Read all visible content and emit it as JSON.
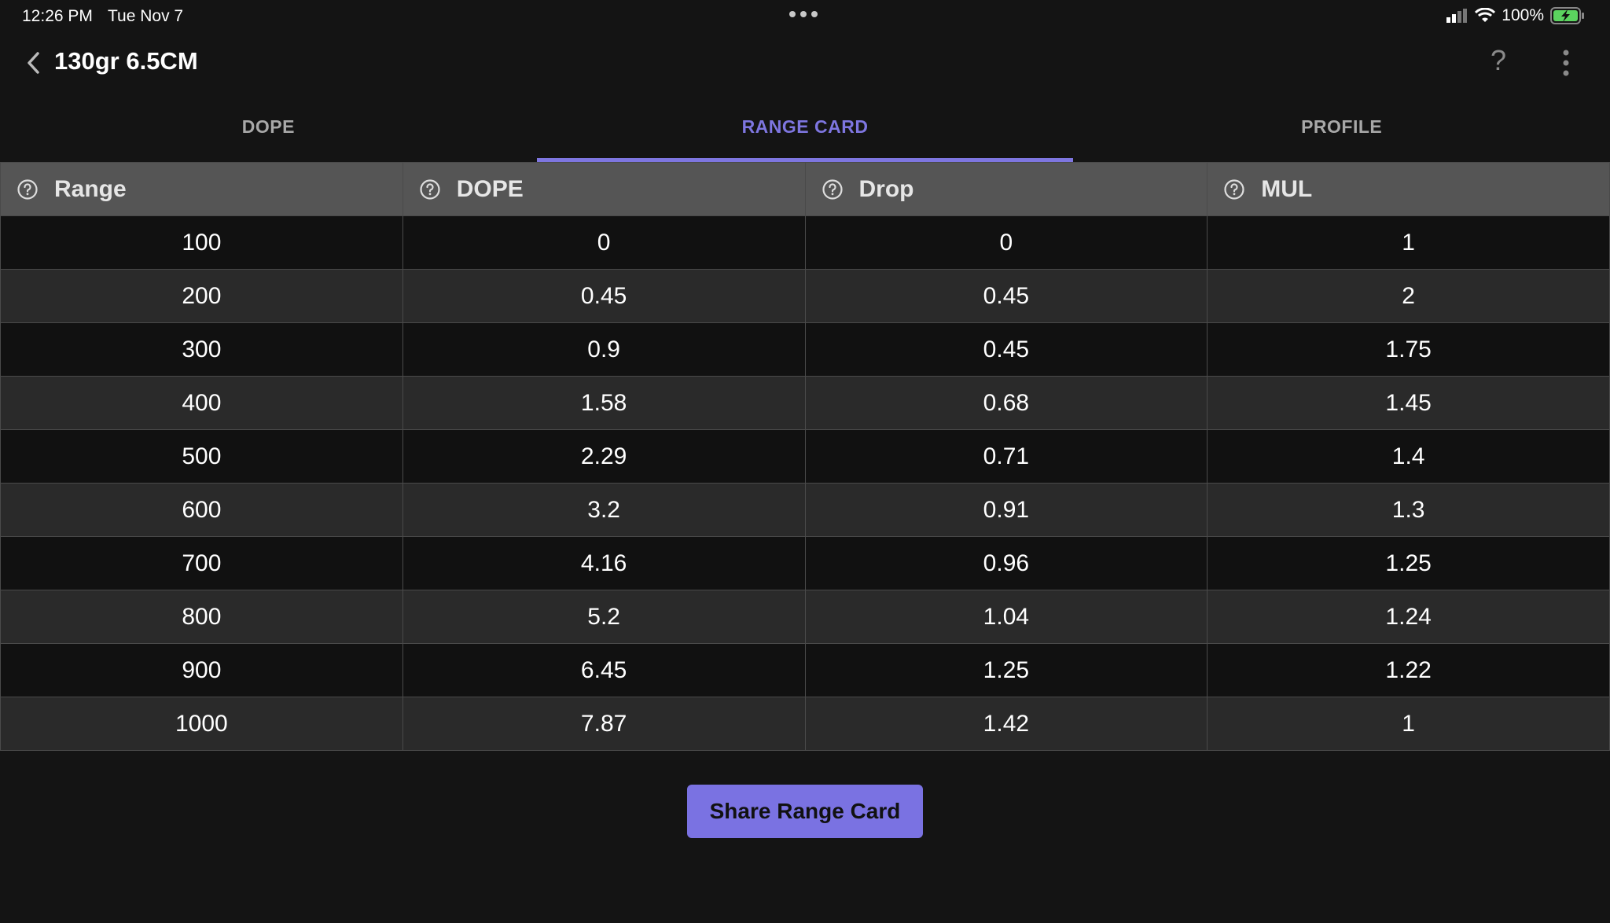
{
  "status_bar": {
    "time": "12:26 PM",
    "date": "Tue Nov 7",
    "battery_percent": "100%",
    "icons": [
      "signal-icon",
      "wifi-icon",
      "battery-charging-icon"
    ]
  },
  "header": {
    "title": "130gr 6.5CM",
    "help_label": "?"
  },
  "tabs": [
    {
      "label": "DOPE",
      "active": false
    },
    {
      "label": "RANGE CARD",
      "active": true
    },
    {
      "label": "PROFILE",
      "active": false
    }
  ],
  "table": {
    "columns": [
      "Range",
      "DOPE",
      "Drop",
      "MUL"
    ],
    "rows": [
      [
        "100",
        "0",
        "0",
        "1"
      ],
      [
        "200",
        "0.45",
        "0.45",
        "2"
      ],
      [
        "300",
        "0.9",
        "0.45",
        "1.75"
      ],
      [
        "400",
        "1.58",
        "0.68",
        "1.45"
      ],
      [
        "500",
        "2.29",
        "0.71",
        "1.4"
      ],
      [
        "600",
        "3.2",
        "0.91",
        "1.3"
      ],
      [
        "700",
        "4.16",
        "0.96",
        "1.25"
      ],
      [
        "800",
        "5.2",
        "1.04",
        "1.24"
      ],
      [
        "900",
        "6.45",
        "1.25",
        "1.22"
      ],
      [
        "1000",
        "7.87",
        "1.42",
        "1"
      ]
    ]
  },
  "share_button_label": "Share Range Card",
  "colors": {
    "accent": "#7e76e0",
    "background": "#141414",
    "header_row": "#555555",
    "row_dark": "#111111",
    "row_light": "#2a2a2a"
  }
}
